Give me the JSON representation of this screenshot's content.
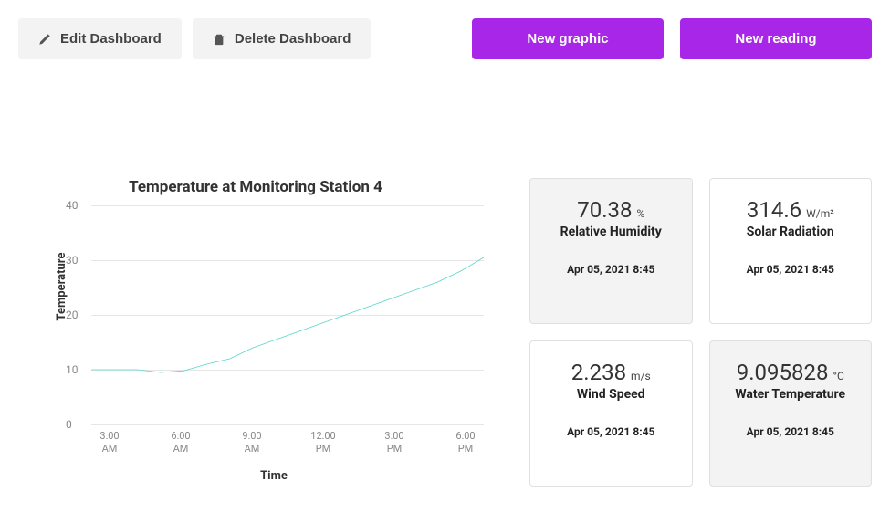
{
  "toolbar": {
    "edit_label": "Edit Dashboard",
    "delete_label": "Delete Dashboard",
    "new_graphic_label": "New graphic",
    "new_reading_label": "New reading"
  },
  "chart_data": {
    "type": "line",
    "title": "Temperature at Monitoring Station 4",
    "xlabel": "Time",
    "ylabel": "Temperature",
    "ylim": [
      0,
      40
    ],
    "y_ticks": [
      0,
      10,
      20,
      30,
      40
    ],
    "x_ticks": [
      "3:00 AM",
      "6:00 AM",
      "9:00 AM",
      "12:00 PM",
      "3:00 PM",
      "6:00 PM"
    ],
    "series": [
      {
        "name": "Temperature",
        "color": "#57d6cc",
        "x": [
          "2:00 AM",
          "3:00 AM",
          "4:00 AM",
          "5:00 AM",
          "6:00 AM",
          "7:00 AM",
          "8:00 AM",
          "9:00 AM",
          "10:00 AM",
          "11:00 AM",
          "12:00 PM",
          "1:00 PM",
          "2:00 PM",
          "3:00 PM",
          "4:00 PM",
          "5:00 PM",
          "6:00 PM",
          "6:30 PM"
        ],
        "values": [
          10,
          10,
          10,
          9.5,
          9.8,
          11,
          12,
          14,
          15.5,
          17,
          18.5,
          20,
          21.5,
          23,
          24.5,
          26,
          28,
          30.5
        ]
      }
    ]
  },
  "cards": [
    {
      "value": "70.38",
      "unit": "%",
      "label": "Relative Humidity",
      "timestamp": "Apr 05, 2021 8:45",
      "shaded": true
    },
    {
      "value": "314.6",
      "unit": "W/m²",
      "label": "Solar Radiation",
      "timestamp": "Apr 05, 2021 8:45",
      "shaded": false
    },
    {
      "value": "2.238",
      "unit": "m/s",
      "label": "Wind Speed",
      "timestamp": "Apr 05, 2021 8:45",
      "shaded": false
    },
    {
      "value": "9.095828",
      "unit": "°C",
      "label": "Water Temperature",
      "timestamp": "Apr 05, 2021 8:45",
      "shaded": true
    }
  ]
}
